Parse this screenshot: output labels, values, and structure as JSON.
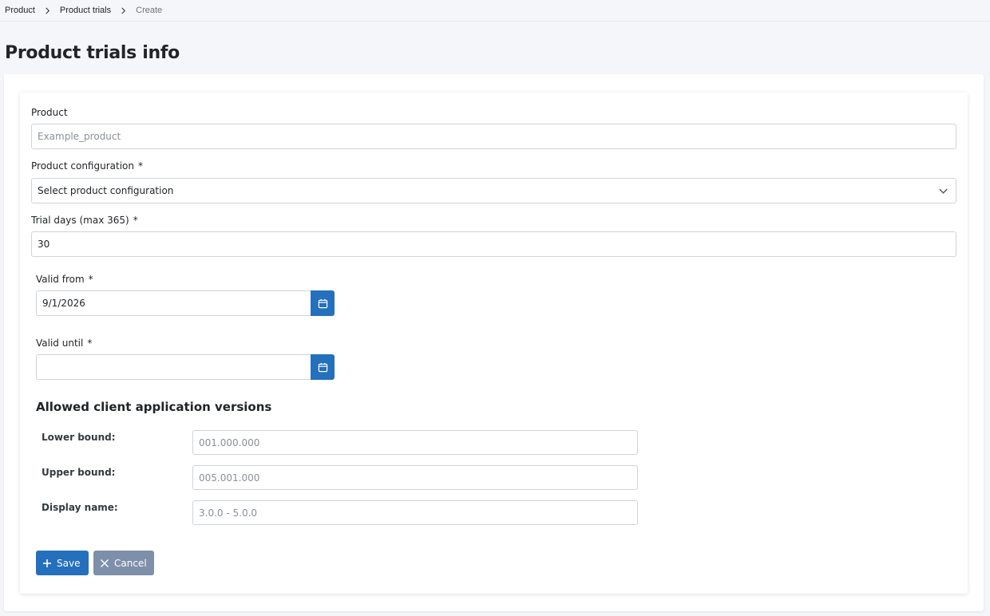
{
  "breadcrumb": {
    "items": [
      "Product",
      "Product trials",
      "Create"
    ]
  },
  "page": {
    "title": "Product trials info"
  },
  "form": {
    "product": {
      "label": "Product",
      "placeholder": "Example_product"
    },
    "product_configuration": {
      "label": "Product configuration",
      "required_mark": "*",
      "selected": "Select product configuration"
    },
    "trial_days": {
      "label": "Trial days (max 365)",
      "required_mark": "*",
      "value": "30"
    },
    "valid_from": {
      "label": "Valid from",
      "required_mark": "*",
      "value": "9/1/2026"
    },
    "valid_until": {
      "label": "Valid until",
      "required_mark": "*",
      "value": ""
    },
    "versions": {
      "title": "Allowed client application versions",
      "lower_bound": {
        "label": "Lower bound:",
        "placeholder": "001.000.000"
      },
      "upper_bound": {
        "label": "Upper bound:",
        "placeholder": "005.001.000"
      },
      "display_name": {
        "label": "Display name:",
        "placeholder": "3.0.0 - 5.0.0"
      }
    },
    "buttons": {
      "save": "Save",
      "cancel": "Cancel"
    }
  },
  "icons": {
    "chevron": "chevron-right-icon",
    "dropdown": "chevron-down-icon",
    "calendar": "calendar-icon",
    "plus": "plus-icon",
    "close": "close-icon"
  },
  "colors": {
    "primary": "#2470bc",
    "secondary": "#7e8fa9",
    "background": "#f4f6f9"
  }
}
